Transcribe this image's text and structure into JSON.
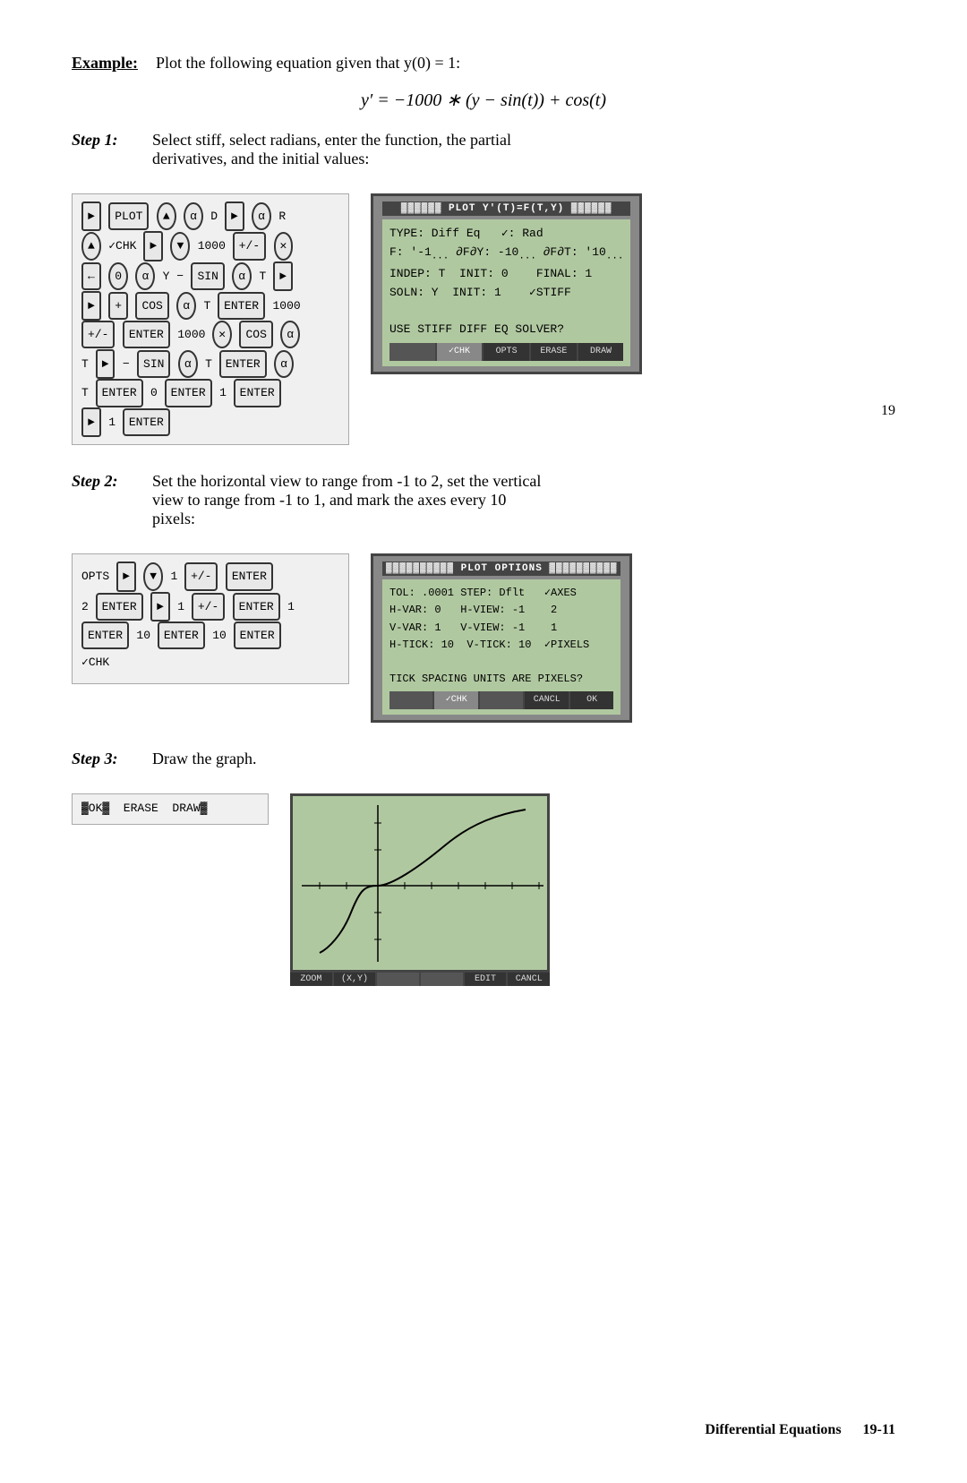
{
  "example": {
    "label": "Example:",
    "text": "Plot the following equation given that y(0) = 1:"
  },
  "equation": "y′ = −1000 * (y − sin(t)) + cos(t)",
  "step1": {
    "label": "Step 1:",
    "text": "Select stiff, select radians, enter the function, the partial",
    "text2": "derivatives, and the initial values:"
  },
  "step2": {
    "label": "Step 2:",
    "text": "Set the horizontal view to range from -1 to 2, set the vertical",
    "text2": "view to range from -1 to 1, and mark the axes every 10",
    "text3": "pixels:"
  },
  "step3": {
    "label": "Step 3:",
    "text": "Draw the graph."
  },
  "screen1": {
    "title": "PLOT Y'(T)=F(T,Y)",
    "rows": [
      "TYPE: Diff Eq    ✓: Rad",
      "F: '-1... ∂F∂Y: -10... ∂F∂T: '10...",
      "INDEP: T  INIT: 0    FINAL: 1",
      "SOLN: Y  INIT: 1    ✓STIFF",
      "USE STIFF DIFF EQ SOLVER?"
    ],
    "softkeys": [
      "",
      "✓CHK",
      "OPTS",
      "ERASE",
      "DRAW"
    ]
  },
  "screen2": {
    "title": "PLOT OPTIONS",
    "rows": [
      "TOL: .0001 STEP: Dflt   ✓AXES",
      "H-VAR: 0   H-VIEW: -1    2",
      "V-VAR: 1   V-VIEW: -1    1",
      "H-TICK: 10  V-TICK: 10  ✓PIXELS",
      "TICK SPACING UNITS ARE PIXELS?"
    ],
    "softkeys": [
      "",
      "✓CHK",
      "",
      "CANCL",
      "OK"
    ]
  },
  "screen3": {
    "softkeys": [
      "ZOOM",
      "(X,Y)",
      "",
      "",
      "EDIT",
      "CANCL"
    ]
  },
  "page_number": "19",
  "footer": {
    "left": "Differential Equations",
    "right": "19-11"
  }
}
